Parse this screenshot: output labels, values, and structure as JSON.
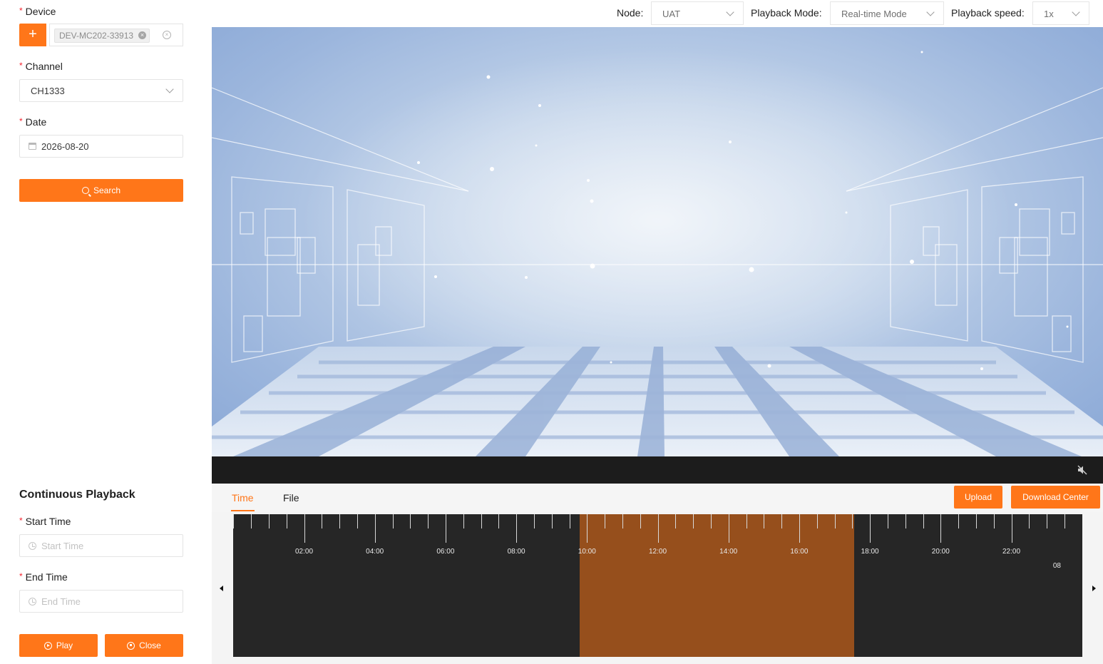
{
  "form": {
    "device_label": "Device",
    "device_tag": "DEV-MC202-33913",
    "channel_label": "Channel",
    "channel_value": "CH1333",
    "date_label": "Date",
    "date_value": "2026-08-20",
    "search_label": "Search"
  },
  "continuous": {
    "title": "Continuous Playback",
    "start_label": "Start Time",
    "start_placeholder": "Start Time",
    "end_label": "End Time",
    "end_placeholder": "End Time",
    "play_label": "Play",
    "close_label": "Close"
  },
  "topbar": {
    "node_label": "Node:",
    "node_value": "UAT",
    "mode_label": "Playback Mode:",
    "mode_value": "Real-time Mode",
    "speed_label": "Playback speed:",
    "speed_value": "1x"
  },
  "tabs": {
    "time": "Time",
    "file": "File",
    "upload": "Upload",
    "download_center": "Download Center"
  },
  "timeline": {
    "labels": [
      "02:00",
      "04:00",
      "06:00",
      "08:00",
      "10:00",
      "12:00",
      "14:00",
      "16:00",
      "18:00",
      "20:00",
      "22:00"
    ],
    "edge_label": "08",
    "highlight_start_hour": 9.8,
    "highlight_end_hour": 17.55
  },
  "colors": {
    "accent": "#ff7619",
    "timeline_bg": "#262626",
    "timeline_highlight": "#964f1c"
  }
}
